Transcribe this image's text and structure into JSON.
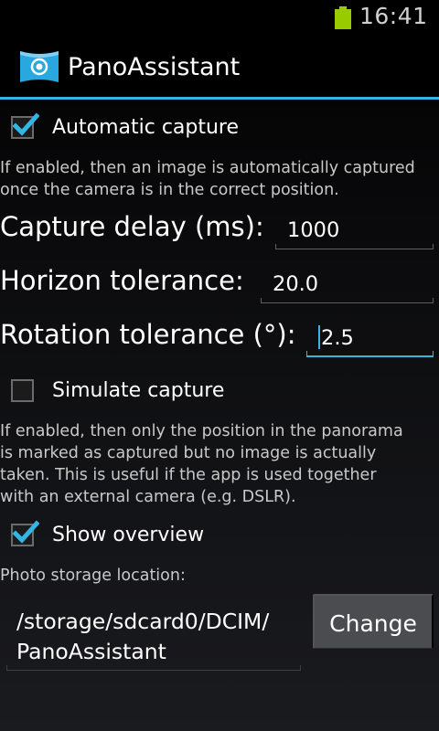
{
  "status_bar": {
    "time": "16:41",
    "battery_color": "#99cc00"
  },
  "action_bar": {
    "title": "PanoAssistant",
    "accent": "#33b5e5"
  },
  "settings": {
    "automatic_capture": {
      "label": "Automatic capture",
      "checked": true,
      "description_line1": "If enabled, then an image is automatically captured",
      "description_line2": "once the camera is in the correct position."
    },
    "capture_delay": {
      "label": "Capture delay (ms):",
      "value": "1000"
    },
    "horizon_tolerance": {
      "label": "Horizon tolerance:",
      "value": "20.0"
    },
    "rotation_tolerance": {
      "label": "Rotation tolerance (°):",
      "value": "2.5",
      "focused": true
    },
    "simulate_capture": {
      "label": "Simulate capture",
      "checked": false,
      "description_line1": "If enabled, then only the position in the panorama",
      "description_line2": "is marked as captured but no image is actually",
      "description_line3": "taken. This is useful if the app is used together",
      "description_line4": "with an external camera (e.g. DSLR)."
    },
    "show_overview": {
      "label": "Show overview",
      "checked": true
    },
    "photo_storage": {
      "label": "Photo storage location:",
      "path_line1": "/storage/sdcard0/DCIM/",
      "path_line2": "PanoAssistant",
      "change_label": "Change"
    }
  }
}
